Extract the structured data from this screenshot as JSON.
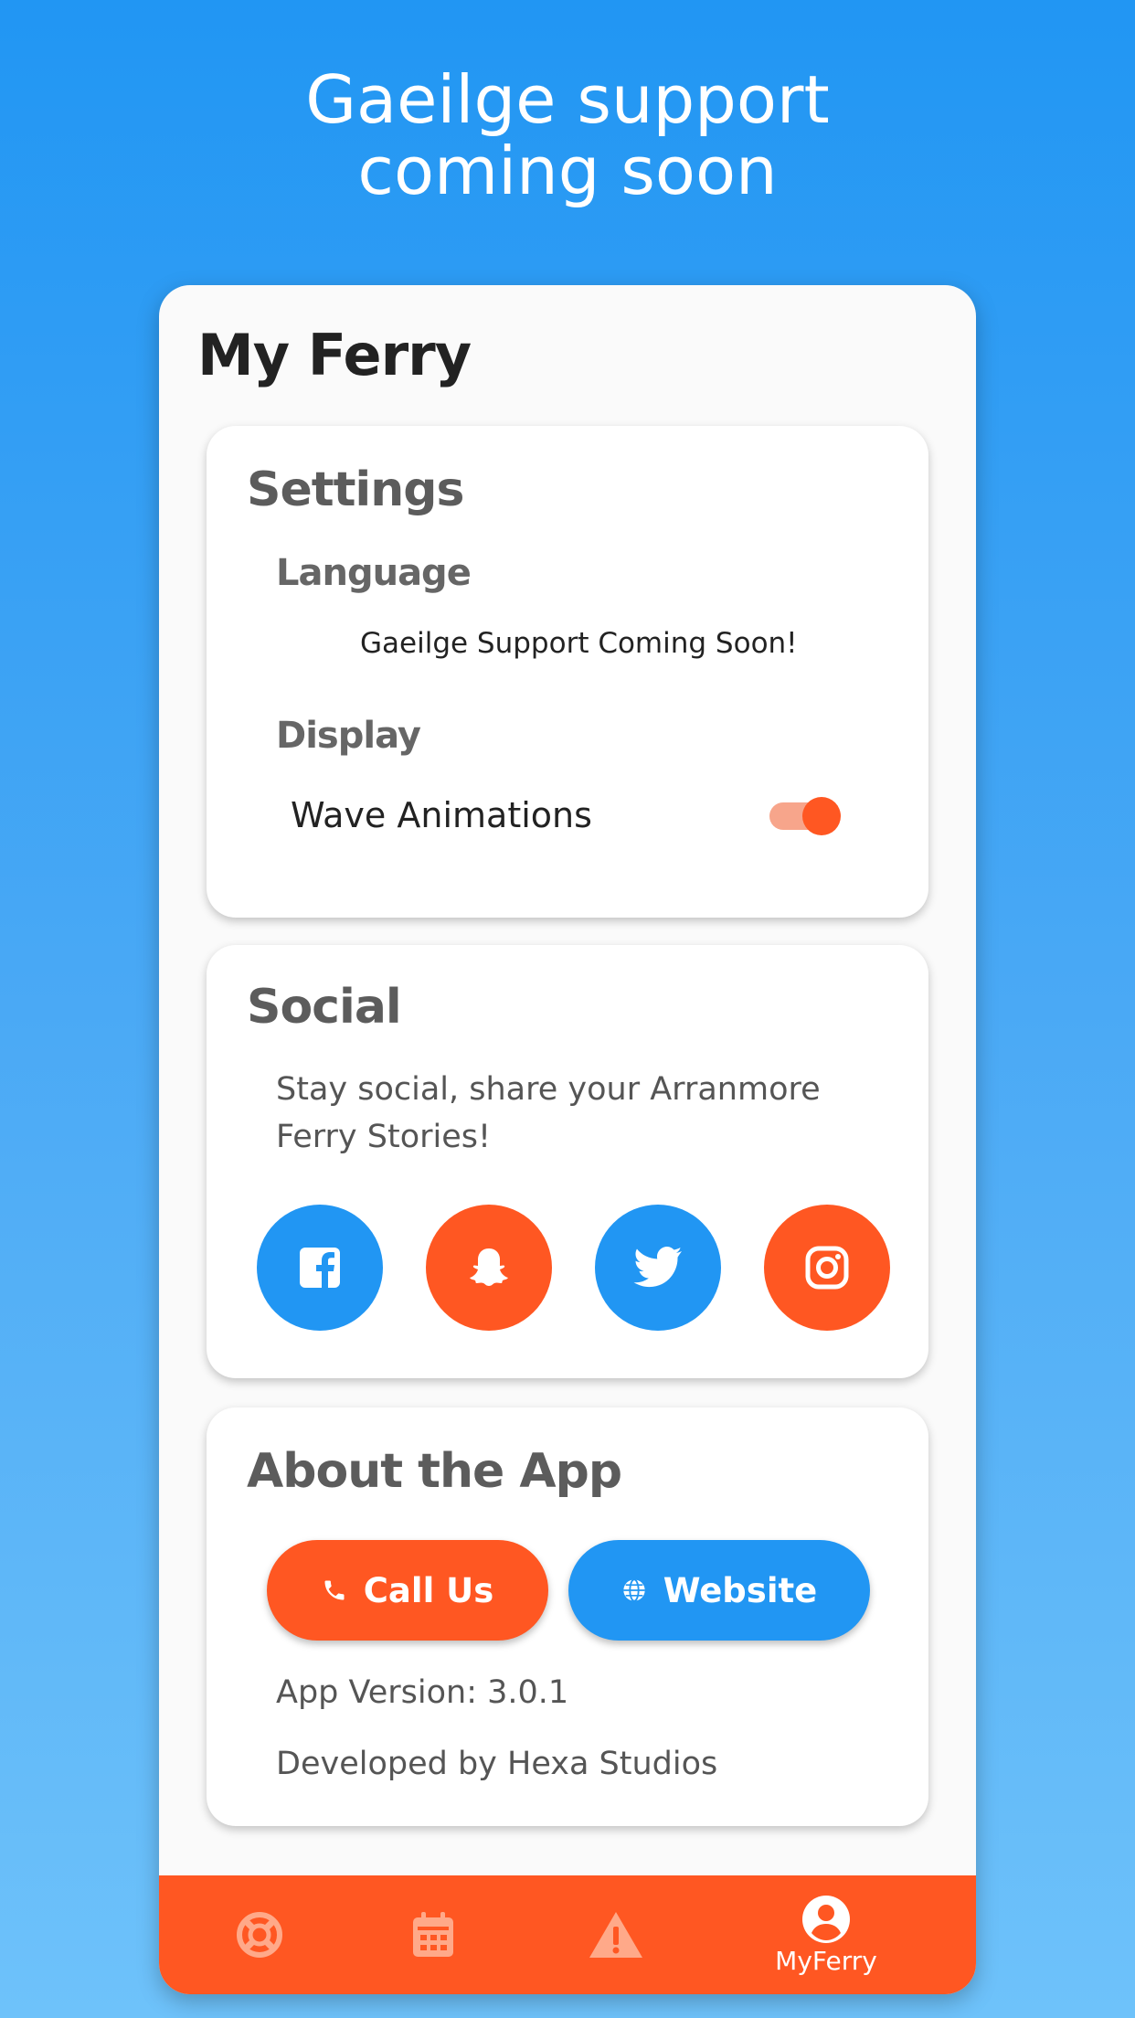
{
  "banner": {
    "line1": "Gaeilge support",
    "line2": "coming soon"
  },
  "screen": {
    "title": "My Ferry",
    "settings": {
      "title": "Settings",
      "language_label": "Language",
      "language_note": "Gaeilge Support Coming Soon!",
      "display_label": "Display",
      "wave_label": "Wave Animations",
      "wave_enabled": true
    },
    "social": {
      "title": "Social",
      "text_line1": "Stay social, share your Arranmore",
      "text_line2": "Ferry Stories!",
      "buttons": [
        {
          "icon": "facebook-icon",
          "color": "#2196F3"
        },
        {
          "icon": "snapchat-icon",
          "color": "#FF5722"
        },
        {
          "icon": "twitter-icon",
          "color": "#2196F3"
        },
        {
          "icon": "instagram-icon",
          "color": "#FF5722"
        }
      ]
    },
    "about": {
      "title": "About the App",
      "call_label": "Call Us",
      "website_label": "Website",
      "version": "App Version: 3.0.1",
      "developer": "Developed by Hexa Studios"
    },
    "nav": {
      "items": [
        {
          "icon": "lifebuoy-icon",
          "active": false
        },
        {
          "icon": "calendar-icon",
          "active": false
        },
        {
          "icon": "warning-icon",
          "active": false
        },
        {
          "icon": "account-icon",
          "label": "MyFerry",
          "active": true
        }
      ]
    }
  },
  "colors": {
    "blue": "#2196F3",
    "orange": "#FF5722",
    "toggle_track": "#F7A58B"
  }
}
